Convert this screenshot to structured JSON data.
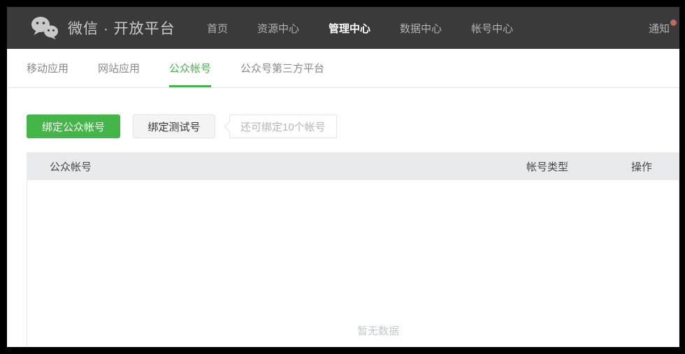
{
  "navbar": {
    "brand": "微信 · 开放平台",
    "items": [
      {
        "label": "首页",
        "active": false
      },
      {
        "label": "资源中心",
        "active": false
      },
      {
        "label": "管理中心",
        "active": true
      },
      {
        "label": "数据中心",
        "active": false
      },
      {
        "label": "帐号中心",
        "active": false
      }
    ],
    "notice_label": "通知",
    "has_notification": true
  },
  "tabs": [
    {
      "label": "移动应用",
      "active": false
    },
    {
      "label": "网站应用",
      "active": false
    },
    {
      "label": "公众帐号",
      "active": true
    },
    {
      "label": "公众号第三方平台",
      "active": false
    }
  ],
  "actions": {
    "bind_official": "绑定公众帐号",
    "bind_test": "绑定测试号",
    "quota_tip": "还可绑定10个帐号"
  },
  "table": {
    "columns": [
      "公众帐号",
      "帐号类型",
      "操作"
    ],
    "rows": [],
    "empty_text": "暂无数据"
  },
  "colors": {
    "brand_green": "#44b549",
    "navbar_bg": "#3a3a3a",
    "notification_dot": "#c0695f",
    "table_header_bg": "#e7ebee"
  }
}
